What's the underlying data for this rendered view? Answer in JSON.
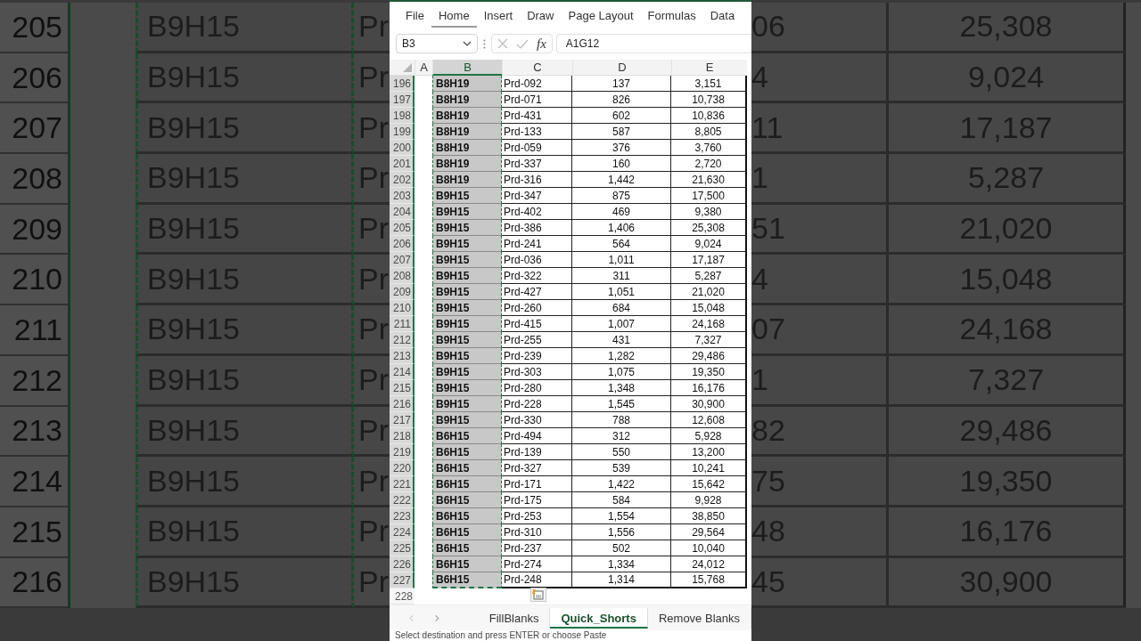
{
  "backdrop_left": [
    {
      "row": "205",
      "col_b": "B9H15",
      "col_c": "Pr"
    },
    {
      "row": "206",
      "col_b": "B9H15",
      "col_c": "Pr"
    },
    {
      "row": "207",
      "col_b": "B9H15",
      "col_c": "Pr"
    },
    {
      "row": "208",
      "col_b": "B9H15",
      "col_c": "Pr"
    },
    {
      "row": "209",
      "col_b": "B9H15",
      "col_c": "Pr"
    },
    {
      "row": "210",
      "col_b": "B9H15",
      "col_c": "Pr"
    },
    {
      "row": "211",
      "col_b": "B9H15",
      "col_c": "Pr"
    },
    {
      "row": "212",
      "col_b": "B9H15",
      "col_c": "Pr"
    },
    {
      "row": "213",
      "col_b": "B9H15",
      "col_c": "Pr"
    },
    {
      "row": "214",
      "col_b": "B9H15",
      "col_c": "Pr"
    },
    {
      "row": "215",
      "col_b": "B9H15",
      "col_c": "Pr"
    },
    {
      "row": "216",
      "col_b": "B9H15",
      "col_c": "Pr"
    }
  ],
  "backdrop_right": [
    {
      "col_d": "06",
      "col_e": "25,308"
    },
    {
      "col_d": "4",
      "col_e": "9,024"
    },
    {
      "col_d": "11",
      "col_e": "17,187"
    },
    {
      "col_d": "1",
      "col_e": "5,287"
    },
    {
      "col_d": "51",
      "col_e": "21,020"
    },
    {
      "col_d": "4",
      "col_e": "15,048"
    },
    {
      "col_d": "07",
      "col_e": "24,168"
    },
    {
      "col_d": "1",
      "col_e": "7,327"
    },
    {
      "col_d": "82",
      "col_e": "29,486"
    },
    {
      "col_d": "75",
      "col_e": "19,350"
    },
    {
      "col_d": "48",
      "col_e": "16,176"
    },
    {
      "col_d": "45",
      "col_e": "30,900"
    }
  ],
  "ribbon_tabs": [
    {
      "label": "File",
      "selected": false
    },
    {
      "label": "Home",
      "selected": true
    },
    {
      "label": "Insert",
      "selected": false
    },
    {
      "label": "Draw",
      "selected": false
    },
    {
      "label": "Page Layout",
      "selected": false
    },
    {
      "label": "Formulas",
      "selected": false
    },
    {
      "label": "Data",
      "selected": false
    }
  ],
  "formula_bar": {
    "name_box": "B3",
    "function_label": "fx",
    "formula": "A1G12"
  },
  "columns": [
    {
      "label": "A",
      "selected": false
    },
    {
      "label": "B",
      "selected": true
    },
    {
      "label": "C",
      "selected": false
    },
    {
      "label": "D",
      "selected": false
    },
    {
      "label": "E",
      "selected": false
    }
  ],
  "rows": [
    {
      "num": "196",
      "selected": true,
      "b": "B8H19",
      "c": "Prd-092",
      "d": "137",
      "e": "3,151"
    },
    {
      "num": "197",
      "selected": true,
      "b": "B8H19",
      "c": "Prd-071",
      "d": "826",
      "e": "10,738"
    },
    {
      "num": "198",
      "selected": true,
      "b": "B8H19",
      "c": "Prd-431",
      "d": "602",
      "e": "10,836"
    },
    {
      "num": "199",
      "selected": true,
      "b": "B8H19",
      "c": "Prd-133",
      "d": "587",
      "e": "8,805"
    },
    {
      "num": "200",
      "selected": true,
      "b": "B8H19",
      "c": "Prd-059",
      "d": "376",
      "e": "3,760"
    },
    {
      "num": "201",
      "selected": true,
      "b": "B8H19",
      "c": "Prd-337",
      "d": "160",
      "e": "2,720"
    },
    {
      "num": "202",
      "selected": true,
      "b": "B8H19",
      "c": "Prd-316",
      "d": "1,442",
      "e": "21,630"
    },
    {
      "num": "203",
      "selected": true,
      "b": "B9H15",
      "c": "Prd-347",
      "d": "875",
      "e": "17,500"
    },
    {
      "num": "204",
      "selected": true,
      "b": "B9H15",
      "c": "Prd-402",
      "d": "469",
      "e": "9,380"
    },
    {
      "num": "205",
      "selected": true,
      "b": "B9H15",
      "c": "Prd-386",
      "d": "1,406",
      "e": "25,308"
    },
    {
      "num": "206",
      "selected": true,
      "b": "B9H15",
      "c": "Prd-241",
      "d": "564",
      "e": "9,024"
    },
    {
      "num": "207",
      "selected": true,
      "b": "B9H15",
      "c": "Prd-036",
      "d": "1,011",
      "e": "17,187"
    },
    {
      "num": "208",
      "selected": true,
      "b": "B9H15",
      "c": "Prd-322",
      "d": "311",
      "e": "5,287"
    },
    {
      "num": "209",
      "selected": true,
      "b": "B9H15",
      "c": "Prd-427",
      "d": "1,051",
      "e": "21,020"
    },
    {
      "num": "210",
      "selected": true,
      "b": "B9H15",
      "c": "Prd-260",
      "d": "684",
      "e": "15,048"
    },
    {
      "num": "211",
      "selected": true,
      "b": "B9H15",
      "c": "Prd-415",
      "d": "1,007",
      "e": "24,168"
    },
    {
      "num": "212",
      "selected": true,
      "b": "B9H15",
      "c": "Prd-255",
      "d": "431",
      "e": "7,327"
    },
    {
      "num": "213",
      "selected": true,
      "b": "B9H15",
      "c": "Prd-239",
      "d": "1,282",
      "e": "29,486"
    },
    {
      "num": "214",
      "selected": true,
      "b": "B9H15",
      "c": "Prd-303",
      "d": "1,075",
      "e": "19,350"
    },
    {
      "num": "215",
      "selected": true,
      "b": "B9H15",
      "c": "Prd-280",
      "d": "1,348",
      "e": "16,176"
    },
    {
      "num": "216",
      "selected": true,
      "b": "B9H15",
      "c": "Prd-228",
      "d": "1,545",
      "e": "30,900"
    },
    {
      "num": "217",
      "selected": true,
      "b": "B9H15",
      "c": "Prd-330",
      "d": "788",
      "e": "12,608"
    },
    {
      "num": "218",
      "selected": true,
      "b": "B6H15",
      "c": "Prd-494",
      "d": "312",
      "e": "5,928"
    },
    {
      "num": "219",
      "selected": true,
      "b": "B6H15",
      "c": "Prd-139",
      "d": "550",
      "e": "13,200"
    },
    {
      "num": "220",
      "selected": true,
      "b": "B6H15",
      "c": "Prd-327",
      "d": "539",
      "e": "10,241"
    },
    {
      "num": "221",
      "selected": true,
      "b": "B6H15",
      "c": "Prd-171",
      "d": "1,422",
      "e": "15,642"
    },
    {
      "num": "222",
      "selected": true,
      "b": "B6H15",
      "c": "Prd-175",
      "d": "584",
      "e": "9,928"
    },
    {
      "num": "223",
      "selected": true,
      "b": "B6H15",
      "c": "Prd-253",
      "d": "1,554",
      "e": "38,850"
    },
    {
      "num": "224",
      "selected": true,
      "b": "B6H15",
      "c": "Prd-310",
      "d": "1,556",
      "e": "29,564"
    },
    {
      "num": "225",
      "selected": true,
      "b": "B6H15",
      "c": "Prd-237",
      "d": "502",
      "e": "10,040"
    },
    {
      "num": "226",
      "selected": true,
      "b": "B6H15",
      "c": "Prd-274",
      "d": "1,334",
      "e": "24,012"
    },
    {
      "num": "227",
      "selected": true,
      "b": "B6H15",
      "c": "Prd-248",
      "d": "1,314",
      "e": "15,768"
    }
  ],
  "empty_row": "228",
  "sheet_tabs": [
    {
      "label": "FillBlanks",
      "selected": false
    },
    {
      "label": "Quick_Shorts",
      "selected": true
    },
    {
      "label": "Remove Blanks",
      "selected": false
    }
  ],
  "status": "Select destination and press ENTER or choose Paste"
}
